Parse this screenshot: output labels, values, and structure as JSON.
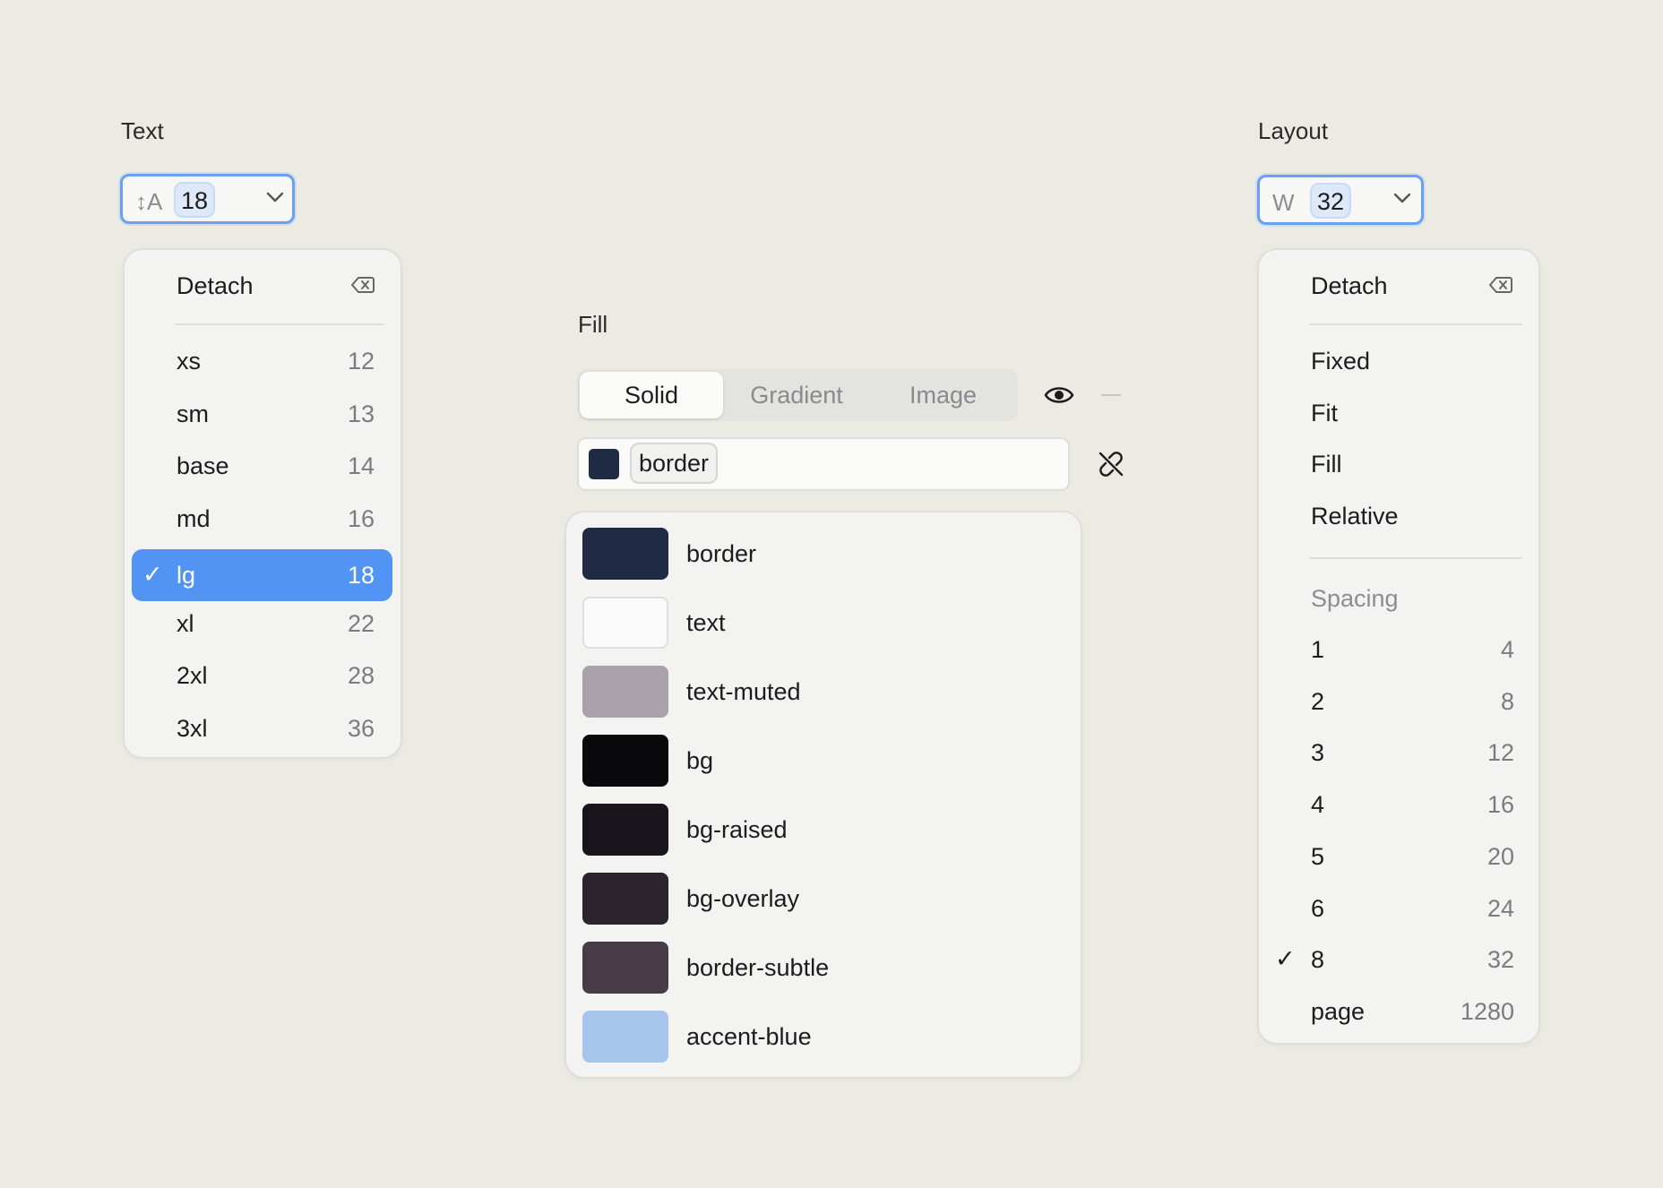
{
  "text_section": {
    "title": "Text",
    "combo": {
      "prefix": "↕A",
      "value": "18"
    },
    "menu": {
      "detach_label": "Detach",
      "items": [
        {
          "label": "xs",
          "value": "12"
        },
        {
          "label": "sm",
          "value": "13"
        },
        {
          "label": "base",
          "value": "14"
        },
        {
          "label": "md",
          "value": "16"
        },
        {
          "label": "lg",
          "value": "18",
          "selected": true
        },
        {
          "label": "xl",
          "value": "22"
        },
        {
          "label": "2xl",
          "value": "28"
        },
        {
          "label": "3xl",
          "value": "36"
        }
      ]
    }
  },
  "fill_section": {
    "title": "Fill",
    "tabs": [
      "Solid",
      "Gradient",
      "Image"
    ],
    "active_tab": "Solid",
    "field": {
      "swatch_color": "#1f2a44",
      "value": "border"
    },
    "swatches": [
      {
        "name": "border",
        "color": "#1f2a44"
      },
      {
        "name": "text",
        "color": "#fafafa"
      },
      {
        "name": "text-muted",
        "color": "#aba1ac"
      },
      {
        "name": "bg",
        "color": "#0a0a0d"
      },
      {
        "name": "bg-raised",
        "color": "#1a151d"
      },
      {
        "name": "bg-overlay",
        "color": "#2b232d"
      },
      {
        "name": "border-subtle",
        "color": "#473c47"
      },
      {
        "name": "accent-blue",
        "color": "#a6c4ec"
      }
    ],
    "icons": {
      "visibility": "eye-icon",
      "remove": "minus-icon",
      "detach": "unlink-icon"
    }
  },
  "layout_section": {
    "title": "Layout",
    "combo": {
      "prefix": "W",
      "value": "32"
    },
    "menu": {
      "detach_label": "Detach",
      "sizing_items": [
        "Fixed",
        "Fit",
        "Fill",
        "Relative"
      ],
      "spacing_header": "Spacing",
      "spacing_items": [
        {
          "label": "1",
          "value": "4"
        },
        {
          "label": "2",
          "value": "8"
        },
        {
          "label": "3",
          "value": "12"
        },
        {
          "label": "4",
          "value": "16"
        },
        {
          "label": "5",
          "value": "20"
        },
        {
          "label": "6",
          "value": "24"
        },
        {
          "label": "8",
          "value": "32",
          "selected": true
        },
        {
          "label": "page",
          "value": "1280"
        }
      ]
    }
  },
  "colors": {
    "accent": "#5294f4",
    "focus_ring": "#6aa0f2"
  },
  "check_glyph": "✓"
}
